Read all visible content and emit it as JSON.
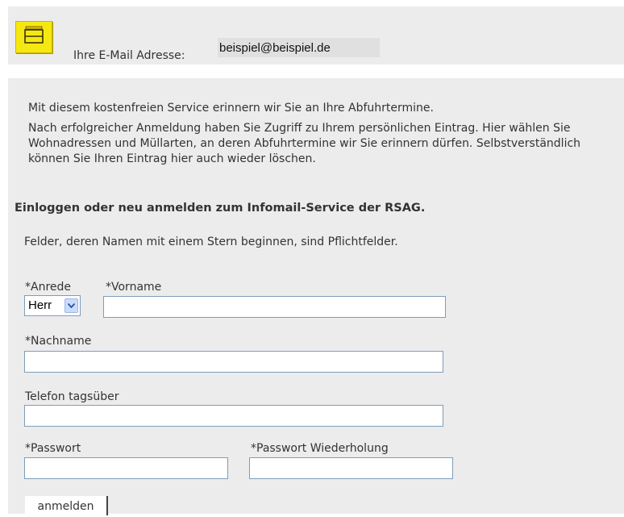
{
  "header": {
    "logo_icon": "mailbox-icon",
    "email_label": "Ihre E-Mail Adresse:",
    "email_value": "beispiel@beispiel.de"
  },
  "intro": {
    "p1": "Mit diesem kostenfreien Service erinnern wir Sie an Ihre Abfuhrtermine.",
    "p2": "Nach erfolgreicher Anmeldung haben Sie Zugriff zu Ihrem persönlichen Eintrag. Hier wählen Sie Wohnadressen und Müllarten, an deren Abfuhrtermine wir Sie erinnern dürfen. Selbstverständlich können Sie Ihren Eintrag hier auch wieder löschen."
  },
  "form": {
    "heading": "Einloggen oder neu anmelden zum Infomail-Service der RSAG.",
    "required_note": "Felder, deren Namen mit einem Stern beginnen, sind Pflichtfelder.",
    "anrede_label": "*Anrede",
    "anrede_value": "Herr",
    "vorname_label": "*Vorname",
    "vorname_value": "",
    "nachname_label": "*Nachname",
    "nachname_value": "",
    "telefon_label": "Telefon tagsüber",
    "telefon_value": "",
    "passwort_label": "*Passwort",
    "passwort_value": "",
    "passwort2_label": "*Passwort Wiederholung",
    "passwort2_value": "",
    "submit_label": "anmelden"
  },
  "colors": {
    "panel_bg": "#ececec",
    "logo_yellow": "#f5e812",
    "input_border": "#7f9db9"
  }
}
